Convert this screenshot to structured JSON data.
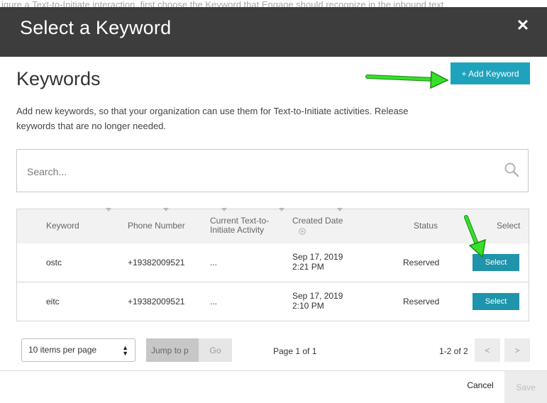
{
  "background_text": "igure a Text-to-Initiate interaction, first choose the Keyword that Engage should recognize in the inbound text",
  "modal": {
    "title": "Select a Keyword",
    "close_symbol": "✕"
  },
  "main": {
    "heading": "Keywords",
    "add_button": "+ Add Keyword",
    "description": "Add new keywords, so that your organization can use them for Text-to-Initiate activities. Release keywords that are no longer needed."
  },
  "search": {
    "placeholder": "Search..."
  },
  "table": {
    "headers": {
      "keyword": "Keyword",
      "phone": "Phone Number",
      "activity_line1": "Current Text-to-",
      "activity_line2": "Initiate Activity",
      "created": "Created Date",
      "status": "Status",
      "select": "Select"
    },
    "rows": [
      {
        "keyword": "ostc",
        "phone": "+19382009521",
        "activity": "...",
        "date": "Sep 17, 2019",
        "time": "2:21 PM",
        "status": "Reserved",
        "action": "Select"
      },
      {
        "keyword": "eitc",
        "phone": "+19382009521",
        "activity": "...",
        "date": "Sep 17, 2019",
        "time": "2:10 PM",
        "status": "Reserved",
        "action": "Select"
      }
    ]
  },
  "pagination": {
    "per_page": "10 items per page",
    "jump_placeholder": "Jump to p",
    "go": "Go",
    "page_label": "Page 1 of 1",
    "count_label": "1-2 of 2",
    "prev": "<",
    "next": ">"
  },
  "footer": {
    "cancel": "Cancel",
    "save": "Save"
  },
  "colors": {
    "header_bg": "#3d3d3d",
    "accent": "#1fa3bd",
    "annotation_arrow": "#33dd22"
  }
}
